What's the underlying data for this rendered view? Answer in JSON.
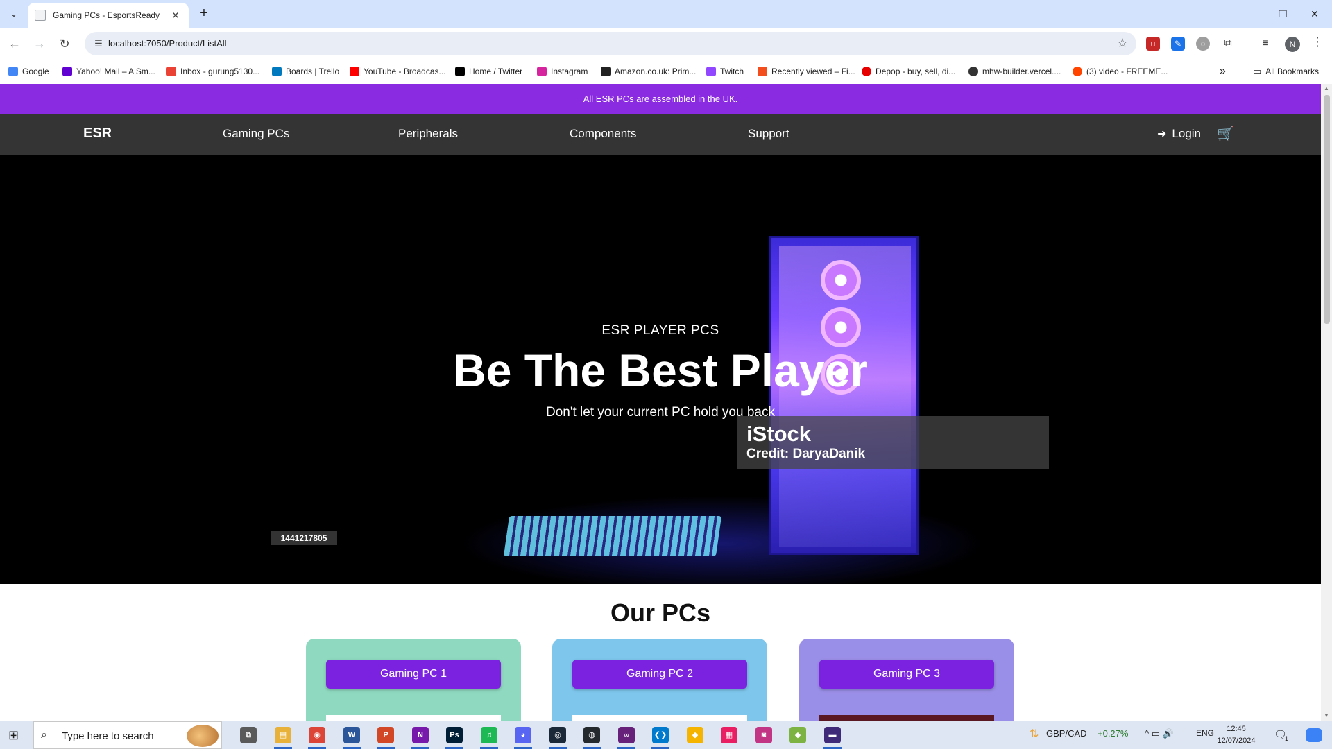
{
  "browser": {
    "tab_title": "Gaming PCs - EsportsReady",
    "tab_close": "✕",
    "new_tab": "+",
    "url": "localhost:7050/Product/ListAll",
    "profile_initial": "N",
    "window_controls": [
      "–",
      "❐",
      "✕"
    ],
    "icons": {
      "tab_search": "chevron-down-icon",
      "back": "back-arrow-icon",
      "forward": "forward-arrow-icon",
      "reload": "reload-icon",
      "bookmark_star": "star-icon"
    },
    "nav_glyphs": {
      "back": "←",
      "forward": "→",
      "reload": "↻",
      "star": "☆",
      "kebab": "⋮",
      "tab_search": "⌄"
    },
    "bookmarks": [
      {
        "label": "Google",
        "color": "#4285f4"
      },
      {
        "label": "Yahoo! Mail – A Sm...",
        "color": "#6001d2"
      },
      {
        "label": "Inbox - gurung5130...",
        "color": "#ea4335"
      },
      {
        "label": "Boards | Trello",
        "color": "#0079bf"
      },
      {
        "label": "YouTube - Broadcas...",
        "color": "#ff0000"
      },
      {
        "label": "Home / Twitter",
        "color": "#000000"
      },
      {
        "label": "Instagram",
        "color": "#d6249f"
      },
      {
        "label": "Amazon.co.uk: Prim...",
        "color": "#222222"
      },
      {
        "label": "Twitch",
        "color": "#9146ff"
      },
      {
        "label": "Recently viewed – Fi...",
        "color": "#f24e1e"
      },
      {
        "label": "Depop - buy, sell, di...",
        "color": "#e60000"
      },
      {
        "label": "mhw-builder.vercel....",
        "color": "#333333"
      },
      {
        "label": "(3) video - FREEME...",
        "color": "#ff4500"
      }
    ],
    "bookmarks_overflow": "»",
    "all_bookmarks": "All Bookmarks"
  },
  "site": {
    "promo": "All ESR PCs are assembled in the UK.",
    "brand": "ESR",
    "nav": [
      "Gaming PCs",
      "Peripherals",
      "Components",
      "Support"
    ],
    "login": "Login",
    "login_glyph": "➜",
    "cart_glyph": "🛒",
    "accent": "#8a2be2"
  },
  "hero": {
    "kicker": "ESR PLAYER PCS",
    "title": "Be The Best Player",
    "subtitle": "Don't let your current PC hold you back",
    "watermark_brand": "iStock",
    "watermark_credit": "Credit: DaryaDanik",
    "stock_id": "1441217805"
  },
  "products": {
    "section_title": "Our PCs",
    "cards": [
      {
        "label": "Gaming PC 1",
        "bg": "#8fd9c0"
      },
      {
        "label": "Gaming PC 2",
        "bg": "#7ec6ec"
      },
      {
        "label": "Gaming PC 3",
        "bg": "#9a8fe8"
      }
    ]
  },
  "taskbar": {
    "search_placeholder": "Type here to search",
    "start_glyph": "⊞",
    "search_glyph": "⌕",
    "apps": [
      {
        "name": "task-view",
        "glyph": "⧉",
        "color": "#5a5a5a"
      },
      {
        "name": "file-explorer",
        "glyph": "▤",
        "color": "#e8b23a"
      },
      {
        "name": "chrome",
        "glyph": "◉",
        "color": "#db4437"
      },
      {
        "name": "word",
        "glyph": "W",
        "color": "#2b579a"
      },
      {
        "name": "powerpoint",
        "glyph": "P",
        "color": "#d24726"
      },
      {
        "name": "onenote",
        "glyph": "N",
        "color": "#7719aa"
      },
      {
        "name": "photoshop",
        "glyph": "Ps",
        "color": "#001e36"
      },
      {
        "name": "spotify",
        "glyph": "♫",
        "color": "#1db954"
      },
      {
        "name": "discord",
        "glyph": "◕",
        "color": "#5865f2"
      },
      {
        "name": "steam",
        "glyph": "◎",
        "color": "#1b2838"
      },
      {
        "name": "github-desktop",
        "glyph": "◍",
        "color": "#24292e"
      },
      {
        "name": "visual-studio",
        "glyph": "∞",
        "color": "#68217a"
      },
      {
        "name": "vs-code",
        "glyph": "❮❯",
        "color": "#007acc"
      },
      {
        "name": "app-diamond",
        "glyph": "◆",
        "color": "#f4b400"
      },
      {
        "name": "app-grid",
        "glyph": "▦",
        "color": "#e91e63"
      },
      {
        "name": "app-camera",
        "glyph": "◙",
        "color": "#c13584"
      },
      {
        "name": "app-diamond-2",
        "glyph": "◆",
        "color": "#7cb342"
      },
      {
        "name": "app-window",
        "glyph": "▬",
        "color": "#3f2a7a"
      }
    ],
    "ticker_glyph": "⇅",
    "ticker": "GBP/CAD",
    "ticker_change": "+0.27%",
    "tray_glyphs": "^  ▭  🔊",
    "lang": "ENG",
    "time": "12:45",
    "date": "12/07/2024",
    "notification_glyph": "🗨",
    "notification_count": "1"
  }
}
